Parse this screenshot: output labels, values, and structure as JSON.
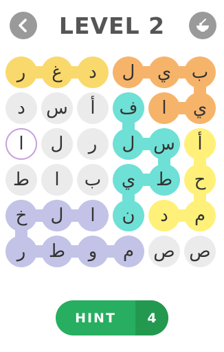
{
  "header": {
    "title": "LEVEL 2"
  },
  "colors": {
    "empty": "#ebebeb",
    "yellow": "#f9d96b",
    "orange": "#f6b46a",
    "teal": "#6fe0d6",
    "lightyellow": "#fff07a",
    "lavender": "#c2c3e6",
    "selected_border": "#c9a0dc"
  },
  "grid": [
    [
      {
        "ch": "ر",
        "c": "yellow"
      },
      {
        "ch": "غ",
        "c": "yellow"
      },
      {
        "ch": "د",
        "c": "yellow"
      },
      {
        "ch": "ل",
        "c": "orange"
      },
      {
        "ch": "ي",
        "c": "orange"
      },
      {
        "ch": "ب",
        "c": "orange"
      }
    ],
    [
      {
        "ch": "د",
        "c": "empty"
      },
      {
        "ch": "س",
        "c": "empty"
      },
      {
        "ch": "أ",
        "c": "empty"
      },
      {
        "ch": "ف",
        "c": "teal"
      },
      {
        "ch": "ا",
        "c": "orange"
      },
      {
        "ch": "ي",
        "c": "orange"
      }
    ],
    [
      {
        "ch": "ا",
        "c": "selected"
      },
      {
        "ch": "ل",
        "c": "empty"
      },
      {
        "ch": "ر",
        "c": "empty"
      },
      {
        "ch": "ل",
        "c": "teal"
      },
      {
        "ch": "س",
        "c": "teal"
      },
      {
        "ch": "أ",
        "c": "lightyellow"
      }
    ],
    [
      {
        "ch": "ط",
        "c": "empty"
      },
      {
        "ch": "ا",
        "c": "empty"
      },
      {
        "ch": "ب",
        "c": "empty"
      },
      {
        "ch": "ي",
        "c": "teal"
      },
      {
        "ch": "ط",
        "c": "teal"
      },
      {
        "ch": "ح",
        "c": "lightyellow"
      }
    ],
    [
      {
        "ch": "خ",
        "c": "lavender"
      },
      {
        "ch": "ل",
        "c": "lavender"
      },
      {
        "ch": "ا",
        "c": "lavender"
      },
      {
        "ch": "ن",
        "c": "teal"
      },
      {
        "ch": "د",
        "c": "lightyellow"
      },
      {
        "ch": "م",
        "c": "lightyellow"
      }
    ],
    [
      {
        "ch": "ر",
        "c": "lavender"
      },
      {
        "ch": "ط",
        "c": "lavender"
      },
      {
        "ch": "و",
        "c": "lavender"
      },
      {
        "ch": "م",
        "c": "lavender"
      },
      {
        "ch": "ص",
        "c": "empty"
      },
      {
        "ch": "ص",
        "c": "empty"
      }
    ]
  ],
  "paths": [
    {
      "color": "yellow",
      "cells": [
        [
          0,
          0
        ],
        [
          0,
          1
        ],
        [
          0,
          2
        ]
      ]
    },
    {
      "color": "orange",
      "cells": [
        [
          0,
          3
        ],
        [
          0,
          4
        ],
        [
          0,
          5
        ],
        [
          1,
          5
        ],
        [
          1,
          4
        ]
      ]
    },
    {
      "color": "teal",
      "cells": [
        [
          1,
          3
        ],
        [
          2,
          3
        ],
        [
          2,
          4
        ],
        [
          3,
          4
        ],
        [
          3,
          3
        ],
        [
          4,
          3
        ]
      ]
    },
    {
      "color": "lightyellow",
      "cells": [
        [
          2,
          5
        ],
        [
          3,
          5
        ],
        [
          4,
          5
        ],
        [
          4,
          4
        ]
      ]
    },
    {
      "color": "lavender",
      "cells": [
        [
          4,
          2
        ],
        [
          4,
          1
        ],
        [
          4,
          0
        ],
        [
          5,
          0
        ],
        [
          5,
          1
        ],
        [
          5,
          2
        ],
        [
          5,
          3
        ]
      ]
    }
  ],
  "hint": {
    "label": "HINT",
    "count": "4"
  }
}
